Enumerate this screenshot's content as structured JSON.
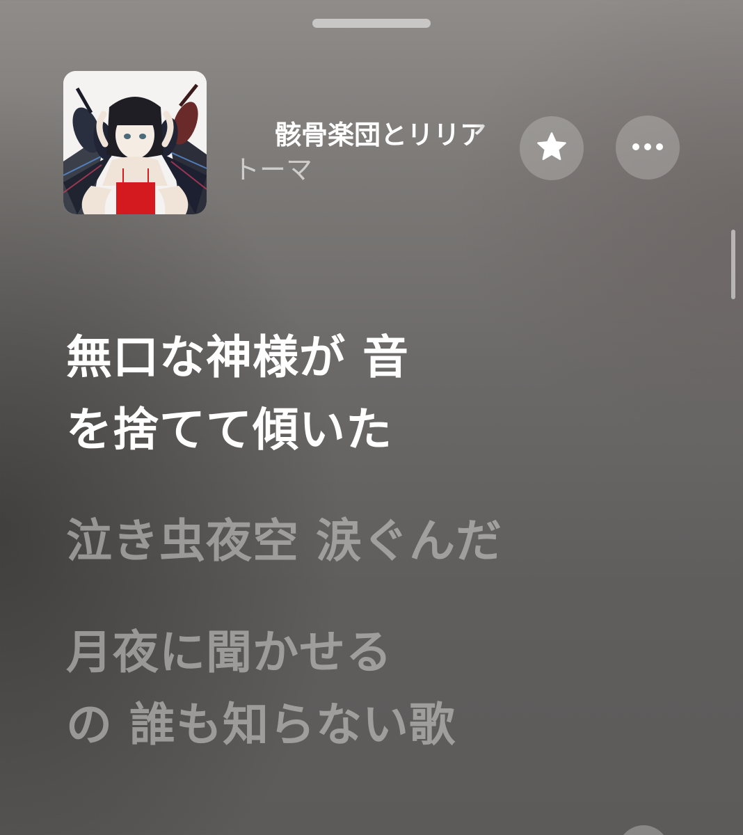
{
  "now_playing": {
    "song_title": "骸骨楽団とリリア",
    "artist": "トーマ",
    "artwork": "album-artwork"
  },
  "controls": {
    "favorite_icon": "star-icon",
    "more_icon": "ellipsis-icon"
  },
  "lyrics": {
    "active_line": {
      "parts": [
        "無口な神様が 音",
        "を捨てて傾いた"
      ]
    },
    "lines": [
      {
        "parts": [
          "泣き虫夜空 涙ぐんだ"
        ]
      },
      {
        "parts": [
          "月夜に聞かせる",
          "の 誰も知らない歌"
        ]
      }
    ]
  },
  "colors": {
    "active_lyric": "#ffffff",
    "inactive_lyric": "#c8c6c5",
    "background": "#6b6968"
  }
}
